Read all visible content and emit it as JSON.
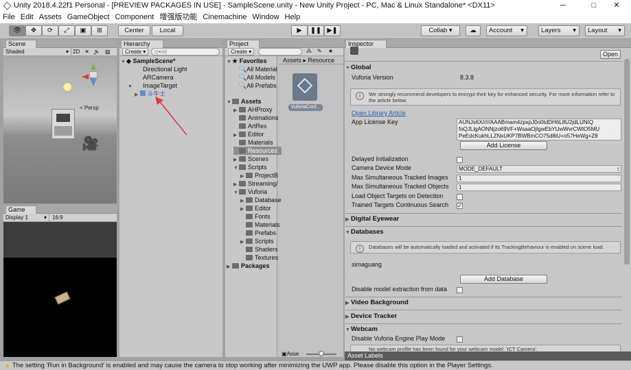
{
  "window": {
    "title": "Unity 2018.4.22f1 Personal - [PREVIEW PACKAGES IN USE] - SampleScene.unity - New Unity Project - PC, Mac & Linux Standalone* <DX11>",
    "minimize": "─",
    "maximize": "□",
    "close": "✕"
  },
  "menu": [
    "File",
    "Edit",
    "Assets",
    "GameObject",
    "Component",
    "增强版功能",
    "Cinemachine",
    "Window",
    "Help"
  ],
  "toolbar": {
    "center": "Center",
    "local": "Local",
    "collab": "Collab ▾",
    "account": "Account",
    "layers": "Layers",
    "layout": "Layout"
  },
  "scene": {
    "tab": "Scene",
    "shading": "Shaded",
    "mode": "2D",
    "persp": "< Persp"
  },
  "game": {
    "tab": "Game",
    "display": "Display 1",
    "aspect": "16:9"
  },
  "hierarchy": {
    "tab": "Hierarchy",
    "create": "Create ▾",
    "search": "Q▾All",
    "scene": "SampleScene*",
    "items": [
      "Directional Light",
      "ARCamera",
      "ImageTarget",
      "斗牛士"
    ]
  },
  "project": {
    "tab": "Project",
    "create": "Create ▾",
    "favorites": "Favorites",
    "fav_items": [
      "All Material",
      "All Models",
      "All Prefabs"
    ],
    "assets": "Assets",
    "asset_items": [
      "AHProxy",
      "Animations",
      "ArtRes",
      "Editor",
      "Materials",
      "Resources",
      "Scenes",
      "Scripts",
      "ProjectB",
      "Streaming/",
      "Vuforia",
      "Database",
      "Editor",
      "Fonts",
      "Materials",
      "Prefabs",
      "Scripts",
      "Shaders",
      "Textures"
    ],
    "packages": "Packages",
    "breadcrumb": [
      "Assets",
      "Resource"
    ],
    "file_name": "VuforiaConf...",
    "footer_label": "Asse"
  },
  "inspector": {
    "tab": "Inspector",
    "open": "Open",
    "global": "Global",
    "vuforia_version_label": "Vuforia Version",
    "vuforia_version": "8.3.8",
    "encrypt_help": "We strongly recommend developers to encrypt their key for enhanced security. For more information refer to the article below.",
    "open_library": "Open Library Article",
    "license_label": "App License Key",
    "license_lines": [
      "AUNJs6X/////AAABmam4zpxpJ0o0tdDH6L8U2jdLUNIQ",
      "foQJLlgAONNjzo69VF+WsaaOjIgwEbYUwWvrCWtO5MU",
      "PeEdcKukhLLZNxUKP7BWBmCO75d8iU+o57HeWg+Z8"
    ],
    "add_license": "Add License",
    "delayed_init": "Delayed Initialization",
    "camera_mode_label": "Camera Device Mode",
    "camera_mode": "MODE_DEFAULT",
    "max_images_label": "Max Simultaneous Tracked Images",
    "max_images": "1",
    "max_objects_label": "Max Simultaneous Tracked Objects",
    "max_objects": "1",
    "load_object_targets": "Load Object Targets on Detection",
    "trained_targets": "Trained Targets Continuous Search",
    "digital_eyewear": "Digital Eyewear",
    "databases": "Databases",
    "db_help": "Databases will be automatically loaded and activated if its TrackingBehaviour is enabled on scene load.",
    "db_name": "simaguang",
    "add_database": "Add Database",
    "disable_model_extraction": "Disable model extraction from data",
    "video_background": "Video Background",
    "device_tracker": "Device Tracker",
    "webcam": "Webcam",
    "disable_play_mode": "Disable Vuforia Engine Play Mode",
    "webcam_help": "No webcam profile has been found for your webcam model: 'ICT Camera'.",
    "asset_labels": "Asset Labels"
  },
  "status": {
    "message": "The setting 'Run in Background' is enabled and may cause the camera to stop working after minimizing the UWP app. Please disable this option in the Player Settings."
  },
  "colors": {
    "selection": "#3d7bd6",
    "arrow": "#e53935",
    "warning": "#e6b400"
  }
}
